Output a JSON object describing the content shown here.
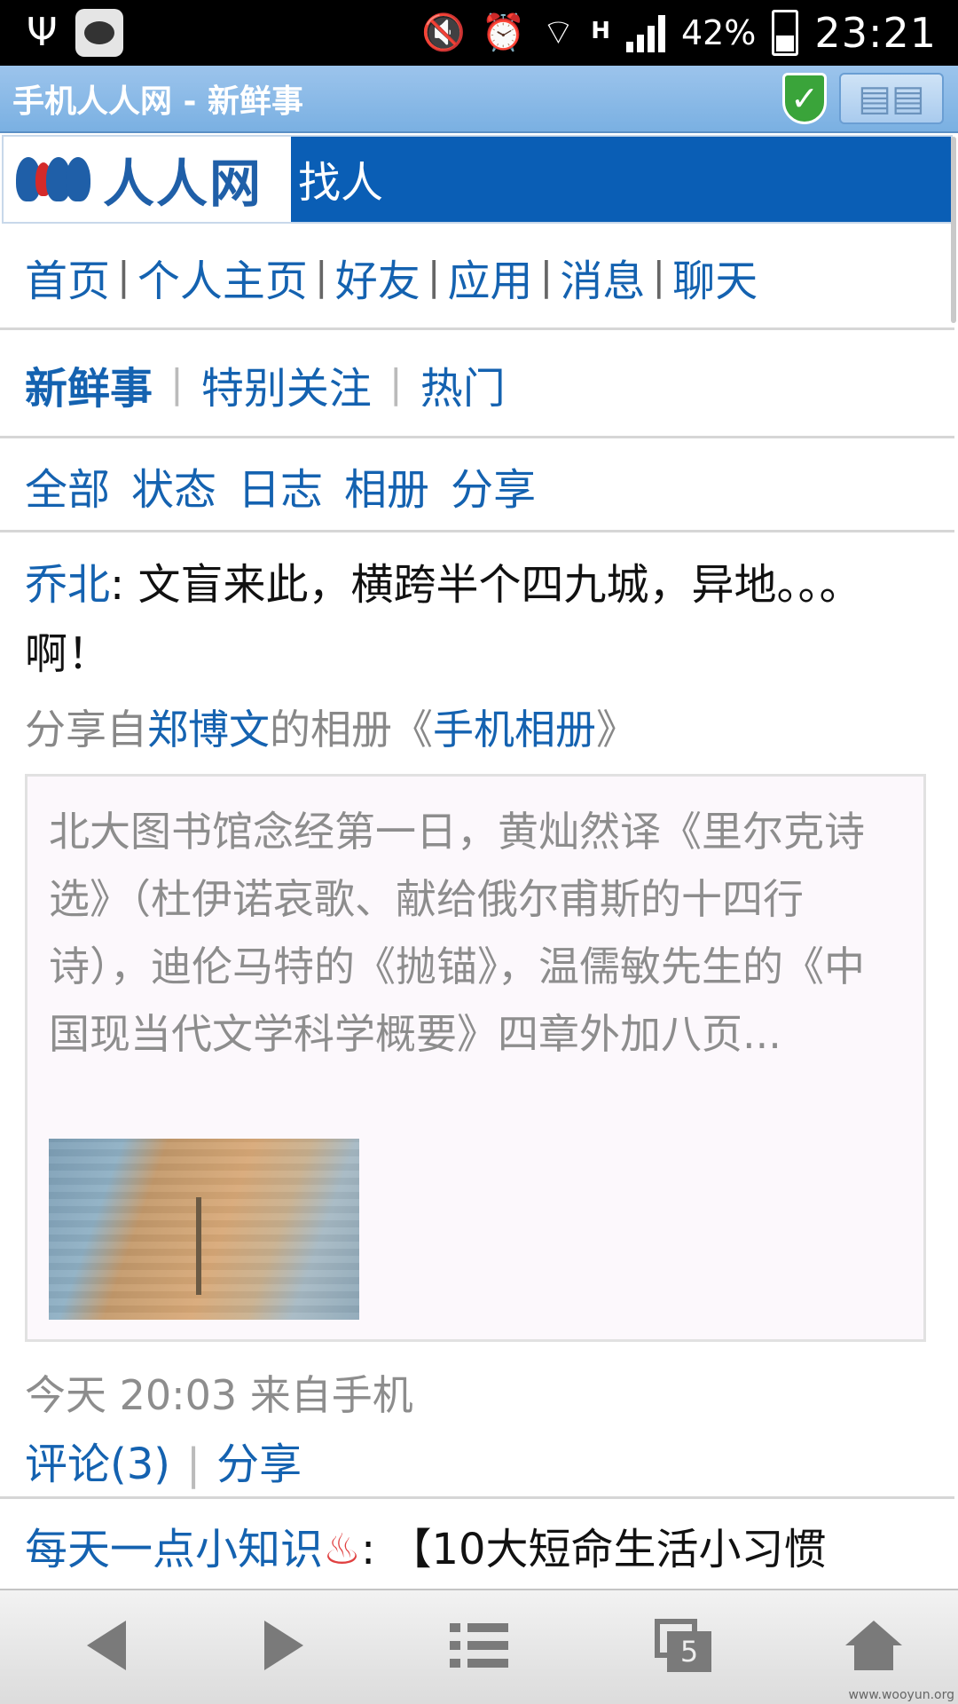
{
  "status_bar": {
    "battery": "42%",
    "time": "23:21",
    "network": "H",
    "icons": [
      "usb-icon",
      "chat-icon",
      "vibrate-mute-icon",
      "alarm-icon",
      "wifi-icon",
      "signal-icon",
      "battery-charging-icon"
    ]
  },
  "browser": {
    "title": "手机人人网 - 新鲜事",
    "icons": [
      "shield-check-icon",
      "reading-mode-icon"
    ]
  },
  "site": {
    "logo_text": "人人网",
    "find_label": "找人"
  },
  "nav_main": [
    "首页",
    "个人主页",
    "好友",
    "应用",
    "消息",
    "聊天"
  ],
  "nav_feed": [
    "新鲜事",
    "特别关注",
    "热门"
  ],
  "nav_filter": [
    "全部",
    "状态",
    "日志",
    "相册",
    "分享"
  ],
  "post": {
    "author": "乔北",
    "colon": ":",
    "text": " 文盲来此，横跨半个四九城，异地。。。啊！",
    "share_prefix": "分享自",
    "share_user": "郑博文",
    "share_mid": "的相册",
    "album_open": "《",
    "album_name": "手机相册",
    "album_close": "》",
    "quote": "北大图书馆念经第一日，黄灿然译《里尔克诗选》（杜伊诺哀歌、献给俄尔甫斯的十四行诗），迪伦马特的《抛锚》，温儒敏先生的《中国现当代文学科学概要》四章外加八页...",
    "meta": "今天 20:03 来自手机",
    "comment_label": "评论(3)",
    "share_label": "分享"
  },
  "next_post": {
    "author": "每天一点小知识",
    "text": ": 【10大短命生活小习惯"
  },
  "toolbar": {
    "tabs_count": "5",
    "icons": [
      "back-icon",
      "forward-icon",
      "menu-icon",
      "tabs-icon",
      "home-icon"
    ]
  },
  "watermark": "www.wooyun.org"
}
